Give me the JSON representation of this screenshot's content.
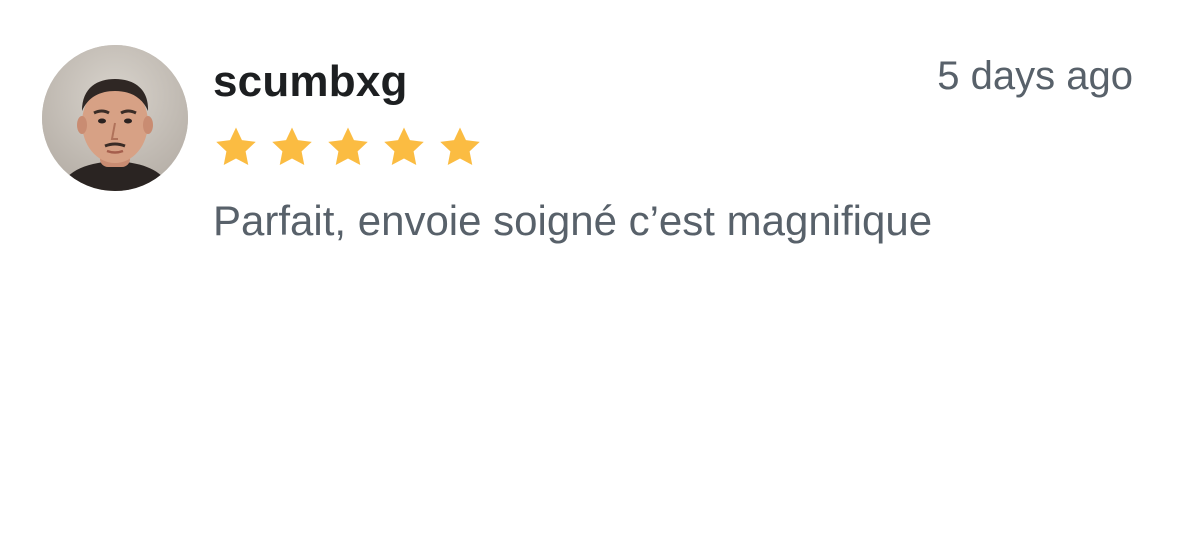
{
  "review": {
    "author": "scumbxg",
    "time_ago": "5 days ago",
    "rating": 5,
    "rating_max": 5,
    "text": "Parfait, envoie soigné c’est magnifique",
    "star_color": "#FBBC42",
    "avatar_icon": "user-avatar-photo"
  }
}
